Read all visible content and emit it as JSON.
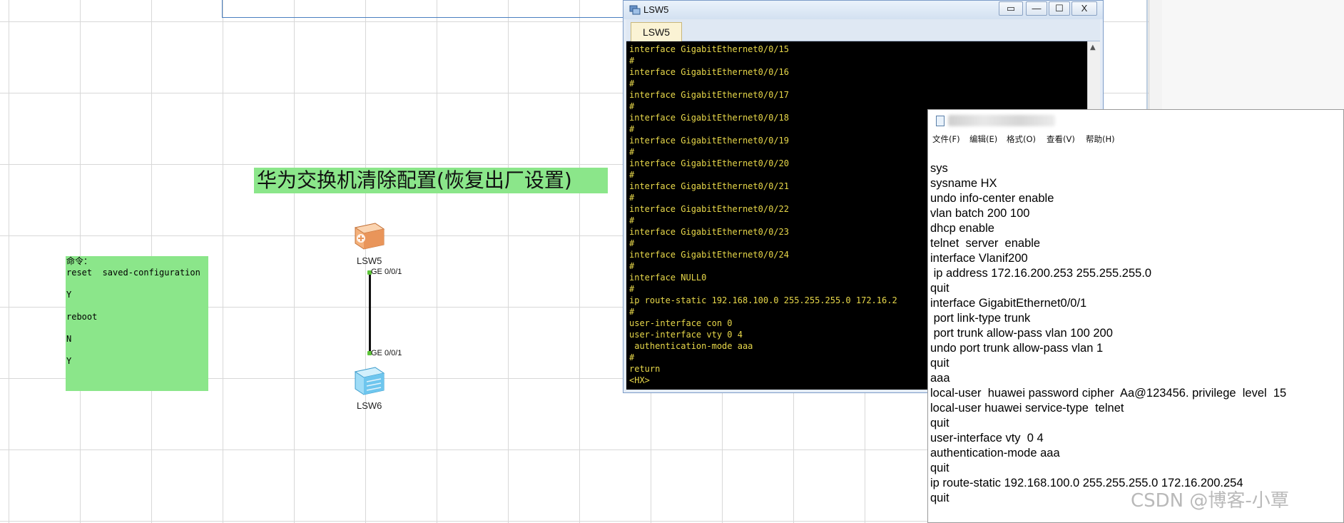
{
  "topology": {
    "banner": "华为交换机清除配置(恢复出厂设置)",
    "note_lines": [
      "命令：",
      "reset  saved-configuration",
      "",
      "Y",
      "",
      "reboot",
      "",
      "N",
      "",
      "Y"
    ],
    "devices": [
      {
        "name": "LSW5",
        "port": "GE 0/0/1"
      },
      {
        "name": "LSW6",
        "port": "GE 0/0/1"
      }
    ],
    "colors": {
      "note_bg": "#8be68a",
      "link": "#111111",
      "port_dot": "#5ec43a"
    }
  },
  "terminal": {
    "title": "LSW5",
    "tab": "LSW5",
    "buttons": {
      "restore": "▭",
      "minimize": "—",
      "maximize": "☐",
      "close": "X"
    },
    "lines": [
      "interface GigabitEthernet0/0/15",
      "#",
      "interface GigabitEthernet0/0/16",
      "#",
      "interface GigabitEthernet0/0/17",
      "#",
      "interface GigabitEthernet0/0/18",
      "#",
      "interface GigabitEthernet0/0/19",
      "#",
      "interface GigabitEthernet0/0/20",
      "#",
      "interface GigabitEthernet0/0/21",
      "#",
      "interface GigabitEthernet0/0/22",
      "#",
      "interface GigabitEthernet0/0/23",
      "#",
      "interface GigabitEthernet0/0/24",
      "#",
      "interface NULL0",
      "#",
      "ip route-static 192.168.100.0 255.255.255.0 172.16.2",
      "#",
      "user-interface con 0",
      "user-interface vty 0 4",
      " authentication-mode aaa",
      "#",
      "return",
      "<HX>"
    ],
    "colors": {
      "background": "#000000",
      "text": "#e8d84a"
    }
  },
  "notepad": {
    "menu": [
      "文件(F)",
      "编辑(E)",
      "格式(O)",
      "查看(V)",
      "帮助(H)"
    ],
    "lines": [
      "sys",
      "sysname HX",
      "undo info-center enable",
      "vlan batch 200 100",
      "dhcp enable",
      "telnet  server  enable",
      "interface Vlanif200",
      " ip address 172.16.200.253 255.255.255.0",
      "quit",
      "interface GigabitEthernet0/0/1",
      " port link-type trunk",
      " port trunk allow-pass vlan 100 200",
      "undo port trunk allow-pass vlan 1",
      "quit",
      "aaa",
      "local-user  huawei password cipher  Aa@123456. privilege  level  15",
      "local-user huawei service-type  telnet",
      "quit",
      "user-interface vty  0 4",
      "authentication-mode aaa",
      "quit",
      "ip route-static 192.168.100.0 255.255.255.0 172.16.200.254",
      "quit"
    ]
  },
  "watermark": "CSDN @博客-小覃"
}
